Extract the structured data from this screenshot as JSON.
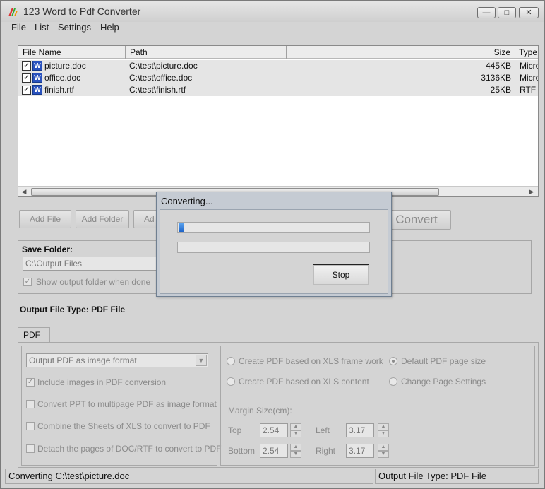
{
  "window": {
    "title": "123 Word to Pdf Converter"
  },
  "menu": [
    "File",
    "List",
    "Settings",
    "Help"
  ],
  "file_list": {
    "columns": [
      "File Name",
      "Path",
      "Size",
      "Type"
    ],
    "rows": [
      {
        "name": "picture.doc",
        "path": "C:\\test\\picture.doc",
        "size": "445KB",
        "type": "Micro",
        "checked": true
      },
      {
        "name": "office.doc",
        "path": "C:\\test\\office.doc",
        "size": "3136KB",
        "type": "Micro",
        "checked": true
      },
      {
        "name": "finish.rtf",
        "path": "C:\\test\\finish.rtf",
        "size": "25KB",
        "type": "RTF",
        "checked": true
      }
    ]
  },
  "buttons": {
    "add_file": "Add File",
    "add_folder": "Add Folder",
    "add_partial": "Ad",
    "convert": "Convert"
  },
  "save_folder": {
    "label": "Save Folder:",
    "path": "C:\\Output Files",
    "show_when_done": "Show output folder when done"
  },
  "output_file_type": "Output File Type:  PDF File",
  "tabs": [
    "PDF"
  ],
  "pdf_options": {
    "format_select": "Output PDF as image format",
    "include_images": "Include images in PDF conversion",
    "convert_ppt": "Convert PPT to multipage PDF as image format",
    "combine_sheets": "Combine the Sheets of XLS to convert to PDF",
    "detach_pages": "Detach the pages of DOC/RTF to convert to PDF"
  },
  "xls_options": {
    "frame_work": "Create PDF based on XLS frame work",
    "content": "Create PDF based on XLS content",
    "default_size": "Default PDF page size",
    "change_settings": "Change Page Settings"
  },
  "margin": {
    "label": "Margin Size(cm):",
    "top_label": "Top",
    "top": "2.54",
    "bottom_label": "Bottom",
    "bottom": "2.54",
    "left_label": "Left",
    "left": "3.17",
    "right_label": "Right",
    "right": "3.17"
  },
  "status": {
    "left": "Converting  C:\\test\\picture.doc",
    "right": "Output File Type:  PDF File"
  },
  "dialog": {
    "title": "Converting...",
    "progress1": 0.03,
    "progress2": 0,
    "stop": "Stop"
  },
  "colors": {
    "progress": "#1e64c8",
    "dialog_frame": "#c5cbd3"
  }
}
